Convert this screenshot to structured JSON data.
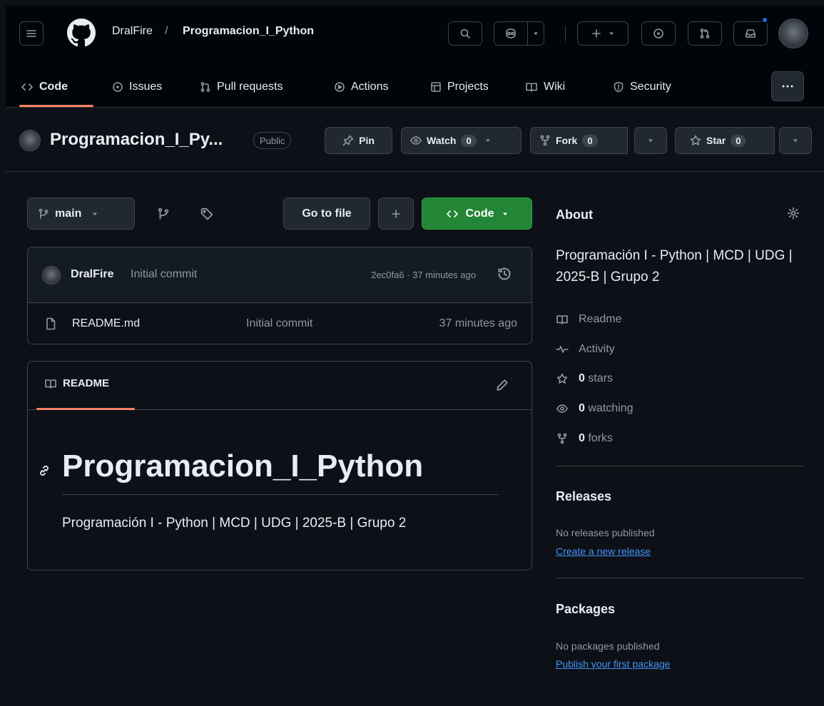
{
  "header": {
    "owner": "DralFire",
    "separator": "/",
    "repo": "Programacion_I_Python"
  },
  "tabs": [
    {
      "label": "Code",
      "icon": "code-icon"
    },
    {
      "label": "Issues",
      "icon": "issues-icon"
    },
    {
      "label": "Pull requests",
      "icon": "pull-request-icon"
    },
    {
      "label": "Actions",
      "icon": "play-icon"
    },
    {
      "label": "Projects",
      "icon": "table-icon"
    },
    {
      "label": "Wiki",
      "icon": "book-icon"
    },
    {
      "label": "Security",
      "icon": "shield-icon"
    }
  ],
  "repobar": {
    "title": "Programacion_I_Py...",
    "visibility": "Public",
    "pin_label": "Pin",
    "watch_label": "Watch",
    "watch_count": "0",
    "fork_label": "Fork",
    "fork_count": "0",
    "star_label": "Star",
    "star_count": "0"
  },
  "toolbar": {
    "branch": "main",
    "goto_file": "Go to file",
    "code_label": "Code"
  },
  "latest_commit": {
    "author": "DralFire",
    "message": "Initial commit",
    "meta": "2ec0fa6 · 37 minutes ago"
  },
  "files": [
    {
      "name": "README.md",
      "message": "Initial commit",
      "time": "37 minutes ago"
    }
  ],
  "readme": {
    "tab_label": "README",
    "heading": "Programacion_I_Python",
    "body": "Programación I - Python | MCD | UDG | 2025-B | Grupo 2"
  },
  "about": {
    "title": "About",
    "description": "Programación I - Python | MCD | UDG | 2025-B | Grupo 2",
    "readme": "Readme",
    "activity": "Activity",
    "stars_count": "0",
    "stars_label": "stars",
    "watching_count": "0",
    "watching_label": "watching",
    "forks_count": "0",
    "forks_label": "forks"
  },
  "releases": {
    "title": "Releases",
    "none": "No releases published",
    "link": "Create a new release"
  },
  "packages": {
    "title": "Packages",
    "none": "No packages published",
    "link": "Publish your first package"
  },
  "colors": {
    "background": "#0d1117",
    "header": "#010409",
    "accent_underline": "#f78166",
    "primary_button": "#238636",
    "link": "#4493f8",
    "notification": "#1f6feb"
  }
}
